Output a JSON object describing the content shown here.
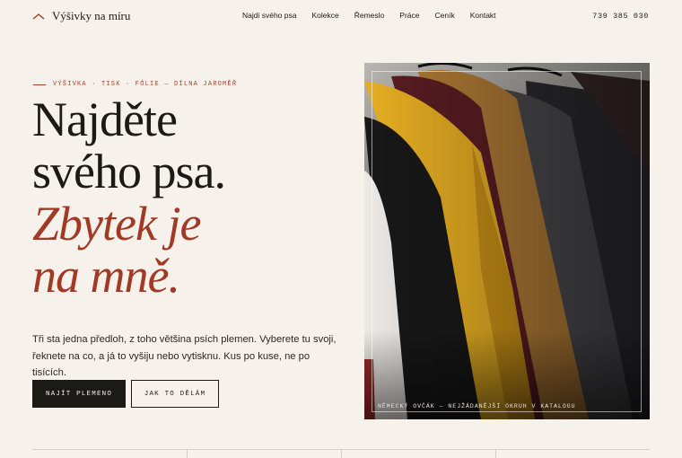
{
  "header": {
    "logo_text": "Výšivky na míru",
    "nav": [
      "Najdi svého psa",
      "Kolekce",
      "Řemeslo",
      "Práce",
      "Ceník",
      "Kontakt"
    ],
    "phone": "739 385 030"
  },
  "hero": {
    "eyebrow": "VÝŠIVKA · TISK · FÓLIE — DÍLNA JAROMĚŘ",
    "headline_lines": [
      "Najděte",
      "svého psa."
    ],
    "headline_accent_lines": [
      "Zbytek je",
      "na mně."
    ],
    "intro_line_1": "Tři sta jedna předloh, z toho většina psích plemen. Vyberete tu svoji,",
    "intro_line_2": "řeknete na co, a já to vyšiju nebo vytisknu. Kus po kuse, ne po tisících.",
    "primary_button": "NAJÍT PLEMENO",
    "secondary_button": "JAK TO DĚLÁM",
    "image_caption": "NĚMECKÝ OVČÁK — NEJŽÁDANĚJŠÍ OKRUH V KATALOGU"
  },
  "colors": {
    "background": "#f6f1ea",
    "text": "#1c1a17",
    "accent": "#a13a24"
  },
  "icons": {
    "logo_mark": "chevron-up-icon"
  }
}
